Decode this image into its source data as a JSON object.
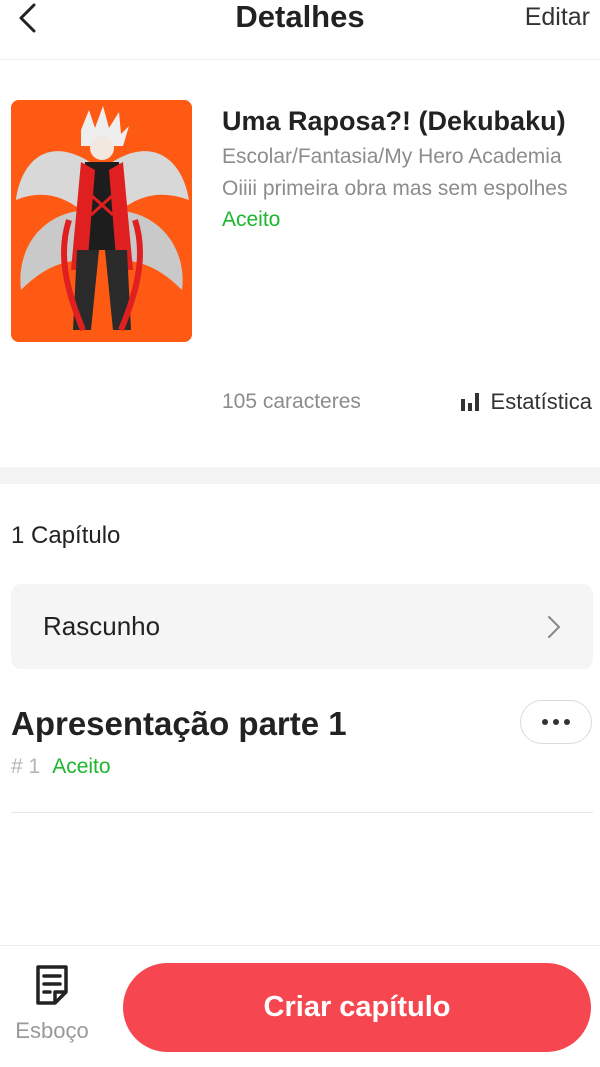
{
  "header": {
    "title": "Detalhes",
    "edit_label": "Editar",
    "back_icon": "chevron-left-icon"
  },
  "story": {
    "title": "Uma Raposa?! (Dekubaku)",
    "genres": "Escolar/Fantasia/My Hero Academia",
    "summary": "Oiiii primeira obra mas sem espolhes",
    "status": "Aceito",
    "char_count": "105 caracteres",
    "stats_label": "Estatística",
    "cover_bg_color": "#ff5a14"
  },
  "chapters": {
    "count_label": "1 Capítulo",
    "draft_label": "Rascunho",
    "items": [
      {
        "title": "Apresentação parte 1",
        "number": "# 1",
        "status": "Aceito"
      }
    ]
  },
  "bottom_bar": {
    "outline_label": "Esboço",
    "create_label": "Criar capítulo"
  },
  "colors": {
    "accent": "#f64650",
    "success": "#1cb62f",
    "muted": "#8c8c8c"
  }
}
